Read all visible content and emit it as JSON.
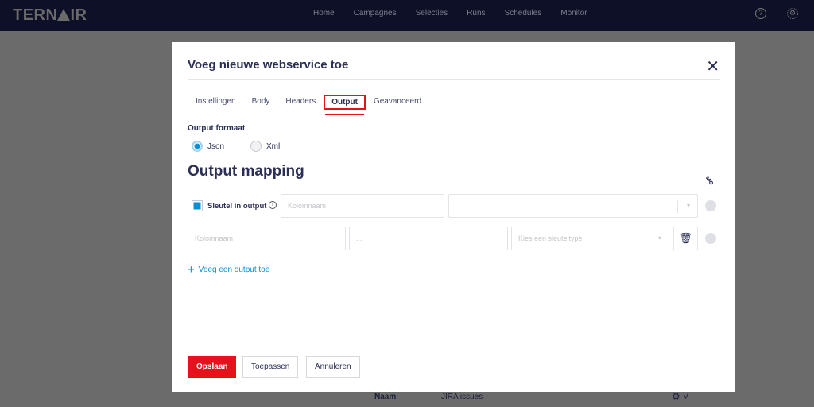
{
  "app": {
    "logo": "TERNAIR",
    "nav": [
      "Home",
      "Campagnes",
      "Selecties",
      "Runs",
      "Schedules",
      "Monitor"
    ]
  },
  "background": {
    "name_label": "Naam",
    "name_value": "JIRA issues"
  },
  "modal": {
    "title": "Voeg nieuwe webservice toe",
    "tabs": [
      "Instellingen",
      "Body",
      "Headers",
      "Output",
      "Geavanceerd"
    ],
    "active_tab": "Output",
    "output_format_label": "Output formaat",
    "formats": [
      "Json",
      "Xml"
    ],
    "selected_format": "Json",
    "mapping_title": "Output mapping",
    "key_in_output_label": "Sleutel in output",
    "row1": {
      "column_placeholder": "Kolomnaam",
      "select_value": ""
    },
    "row2": {
      "column_placeholder": "Kolomnaam",
      "path_placeholder": "...",
      "keytype_placeholder": "Kies een sleuteltype"
    },
    "add_output": "Voeg een output toe",
    "buttons": {
      "save": "Opslaan",
      "apply": "Toepassen",
      "cancel": "Annuleren"
    }
  },
  "colors": {
    "primary": "#e5121b",
    "accent": "#0a8fd6",
    "text": "#2b2f55"
  }
}
